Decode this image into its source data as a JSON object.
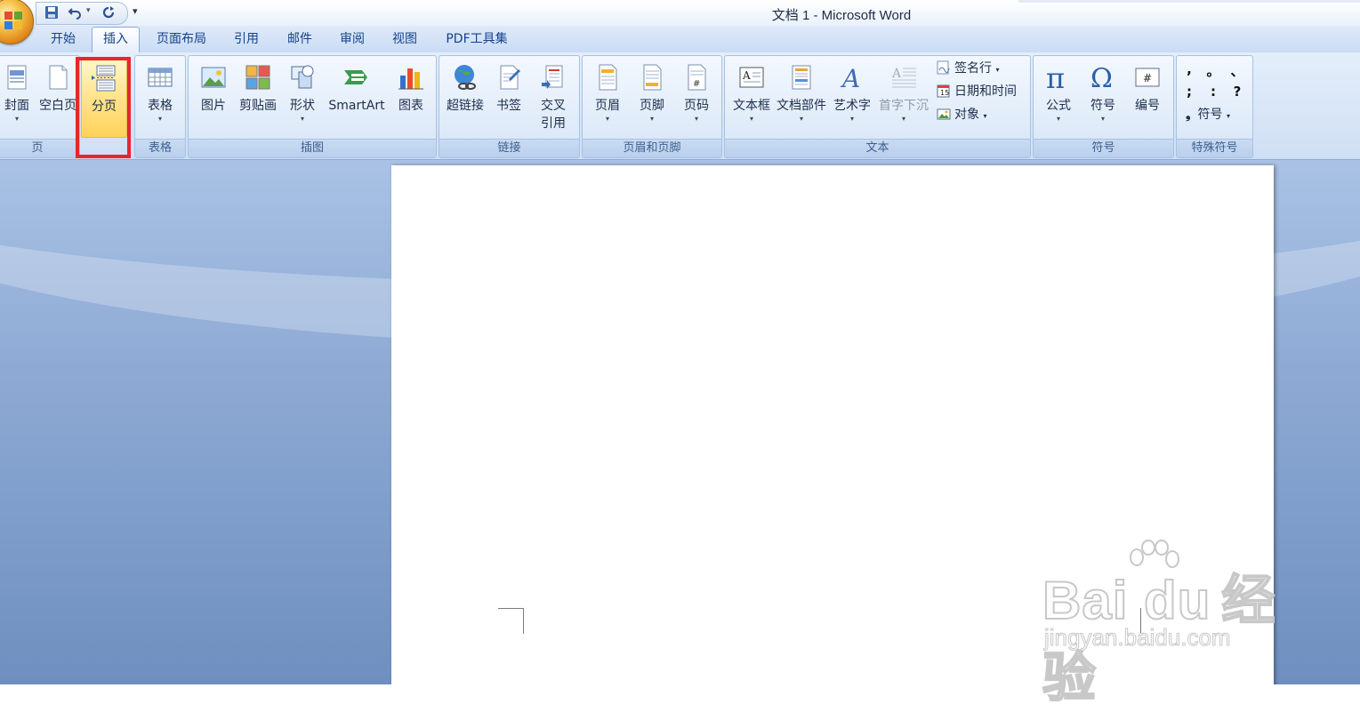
{
  "window": {
    "title": "文档 1 - Microsoft Word"
  },
  "qat": {
    "more": "▾"
  },
  "tabs": [
    "开始",
    "插入",
    "页面布局",
    "引用",
    "邮件",
    "审阅",
    "视图",
    "PDF工具集"
  ],
  "active_tab": "插入",
  "groups": {
    "pages": {
      "label": "页",
      "cover": "封面",
      "blank": "空白页",
      "break": "分页"
    },
    "tables": {
      "label": "表格",
      "table": "表格"
    },
    "illustrations": {
      "label": "插图",
      "picture": "图片",
      "clipart": "剪贴画",
      "shapes": "形状",
      "smartart": "SmartArt",
      "chart": "图表"
    },
    "links": {
      "label": "链接",
      "hyperlink": "超链接",
      "bookmark": "书签",
      "crossref_1": "交叉",
      "crossref_2": "引用"
    },
    "header_footer": {
      "label": "页眉和页脚",
      "header": "页眉",
      "footer": "页脚",
      "page_number": "页码"
    },
    "text": {
      "label": "文本",
      "textbox": "文本框",
      "quickparts": "文档部件",
      "wordart": "艺术字",
      "dropcap": "首字下沉",
      "signature": "签名行",
      "datetime": "日期和时间",
      "object": "对象"
    },
    "symbols": {
      "label": "符号",
      "equation": "公式",
      "symbol": "符号",
      "numbering": "编号"
    },
    "special": {
      "label": "特殊符号",
      "chars": [
        ",",
        "。",
        "、",
        ";",
        ":",
        "?"
      ],
      "symbol": "符号"
    }
  },
  "watermark": {
    "brand": "Bai  du",
    "brand_cn": "经验",
    "url": "jingyan.baidu.com"
  },
  "colors": {
    "highlight": "#e8262b",
    "ribbon_bg": "#dfebf9",
    "workspace": "#8eaad4"
  }
}
